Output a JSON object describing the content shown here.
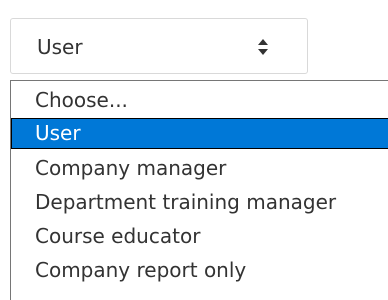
{
  "select": {
    "selected_value": "User",
    "arrow_icon": "sort-arrows-icon"
  },
  "dropdown": {
    "options": [
      {
        "label": "Choose..."
      },
      {
        "label": "User",
        "selected": true
      },
      {
        "label": "Company manager"
      },
      {
        "label": "Department training manager"
      },
      {
        "label": "Course educator"
      },
      {
        "label": "Company report only"
      }
    ]
  },
  "colors": {
    "highlight": "#0078d7",
    "text": "#333333"
  }
}
